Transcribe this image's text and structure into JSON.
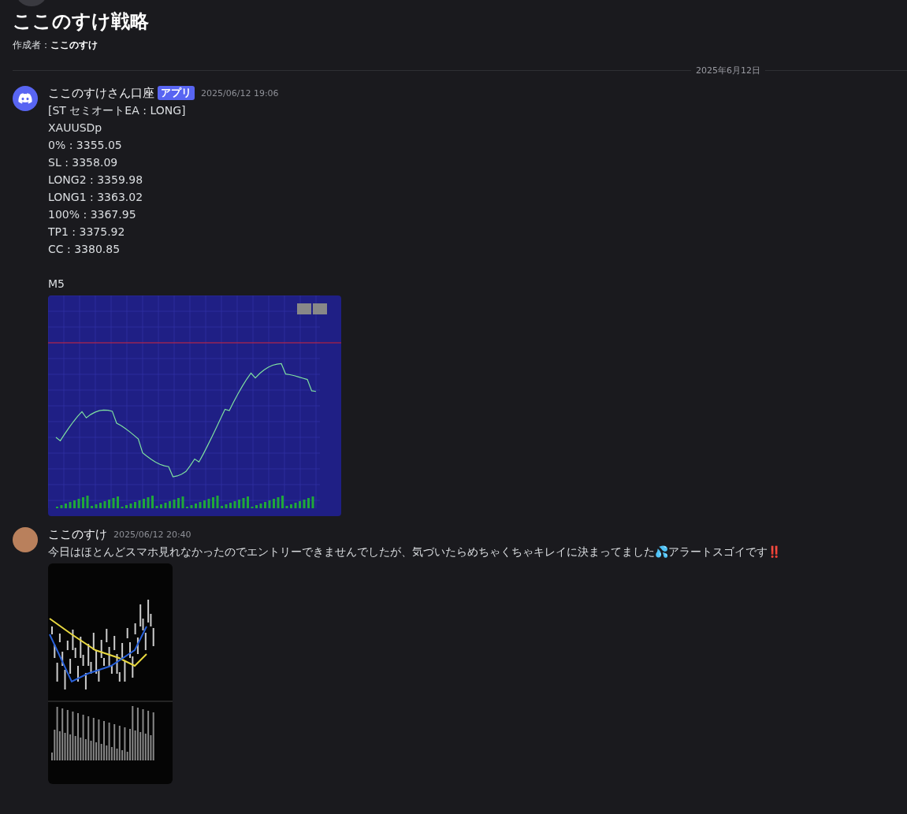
{
  "thread": {
    "title": "ここのすけ戦略",
    "author_label": "作成者：",
    "author": "ここのすけ"
  },
  "date_divider": "2025年6月12日",
  "messages": [
    {
      "kind": "bot",
      "author": "ここのすけさん口座",
      "badge": "アプリ",
      "time": "2025/06/12 19:06",
      "lines": [
        "[ST セミオートEA : LONG]",
        "XAUUSDp",
        "0% : 3355.05",
        "SL : 3358.09",
        "LONG2 : 3359.98",
        "LONG1 : 3363.02",
        "100% : 3367.95",
        "TP1 : 3375.92",
        "CC : 3380.85"
      ],
      "caption": "M5",
      "attachment": {
        "kind": "desktop"
      }
    },
    {
      "kind": "user",
      "author": "ここのすけ",
      "time": "2025/06/12 20:40",
      "text": "今日はほとんどスマホ見れなかったのでエントリーできませんでしたが、気づいたらめちゃくちゃキレイに決まってました💦アラートスゴイです‼️",
      "attachment": {
        "kind": "phone"
      }
    }
  ]
}
